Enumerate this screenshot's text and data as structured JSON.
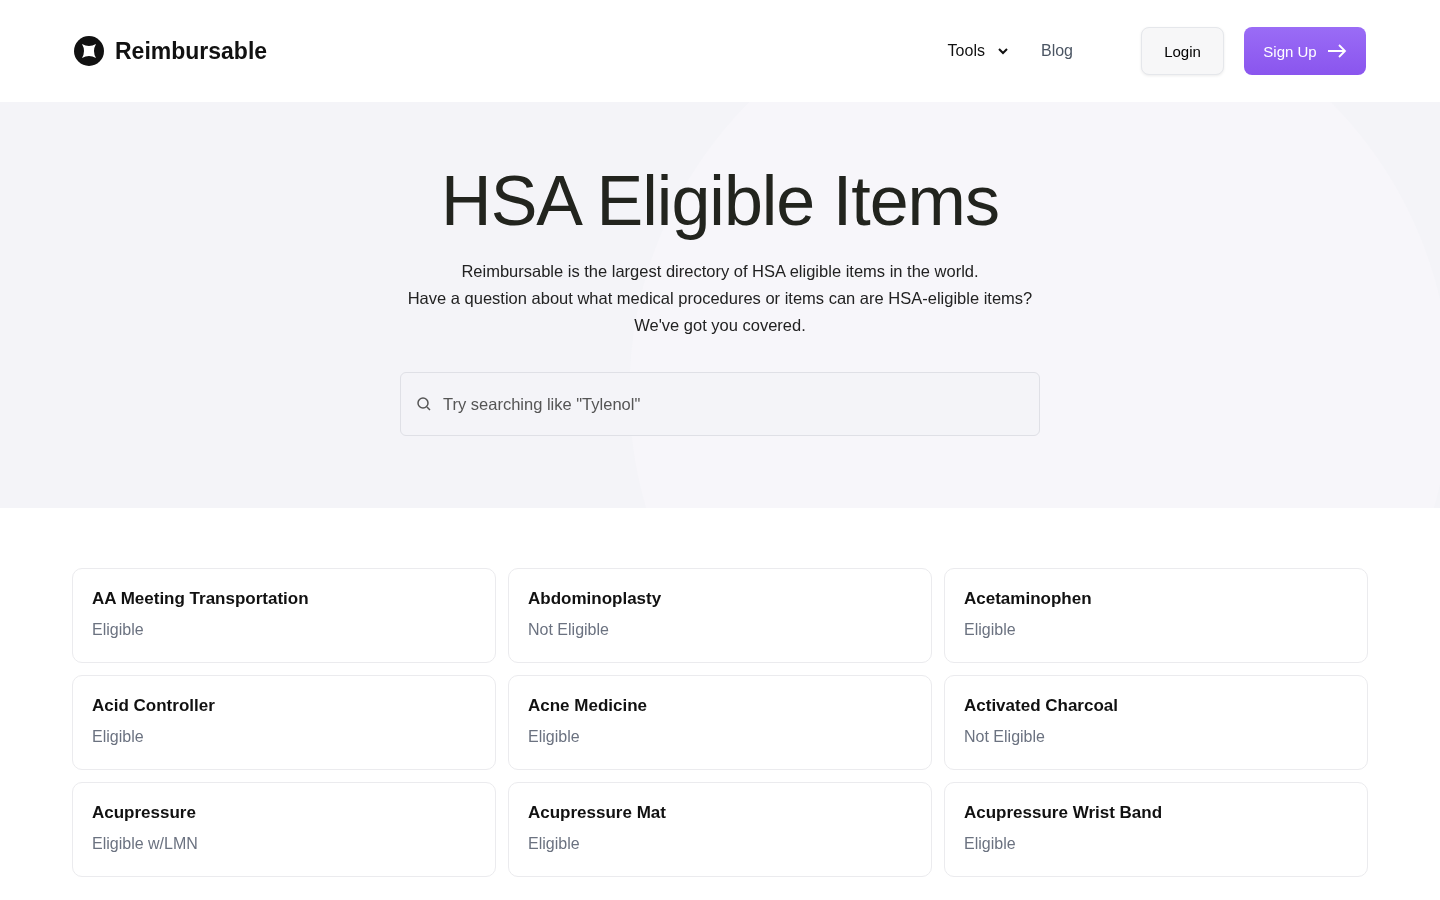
{
  "brand": {
    "name": "Reimbursable"
  },
  "nav": [
    {
      "label": "Tools",
      "kind": "dropdown"
    },
    {
      "label": "Blog",
      "kind": "link"
    }
  ],
  "buttons": [
    {
      "label": "Login",
      "kind": "secondary"
    },
    {
      "label": "Sign Up",
      "kind": "primary"
    }
  ],
  "hero": {
    "title": "HSA Eligible Items",
    "lines": [
      "Reimbursable is the largest directory of HSA eligible items in the world.",
      "Have a question about what medical procedures or items can are HSA-eligible items?",
      "We've got you covered."
    ],
    "search": {
      "placeholder": "Try searching like \"Tylenol\""
    }
  },
  "items": [
    {
      "name": "AA Meeting Transportation",
      "status": "Eligible"
    },
    {
      "name": "Abdominoplasty",
      "status": "Not Eligible"
    },
    {
      "name": "Acetaminophen",
      "status": "Eligible"
    },
    {
      "name": "Acid Controller",
      "status": "Eligible"
    },
    {
      "name": "Acne Medicine",
      "status": "Eligible"
    },
    {
      "name": "Activated Charcoal",
      "status": "Not Eligible"
    },
    {
      "name": "Acupressure",
      "status": "Eligible w/LMN"
    },
    {
      "name": "Acupressure Mat",
      "status": "Eligible"
    },
    {
      "name": "Acupressure Wrist Band",
      "status": "Eligible"
    }
  ]
}
